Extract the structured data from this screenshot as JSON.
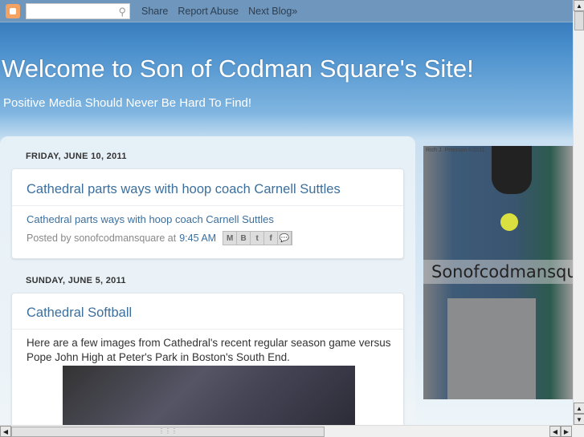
{
  "navbar": {
    "search_placeholder": "",
    "links": [
      "Share",
      "Report Abuse",
      "Next Blog»"
    ]
  },
  "header": {
    "title": "Welcome to Son of Codman Square's Site!",
    "description": "Positive Media Should Never Be Hard To Find!"
  },
  "posts": [
    {
      "date": "FRIDAY, JUNE 10, 2011",
      "title": "Cathedral parts ways with hoop coach Carnell Suttles",
      "body_link": "Cathedral parts ways with hoop coach Carnell Suttles",
      "posted_by": "Posted by sonofcodmansquare at",
      "time": "9:45 AM",
      "share_icons": [
        "M",
        "B",
        "t",
        "f",
        "💬"
      ]
    },
    {
      "date": "SUNDAY, JUNE 5, 2011",
      "title": "Cathedral Softball",
      "body": "Here are a few images from Cathedral's recent regular season game versus Pope John High at Peter's Park in Boston's South End."
    }
  ],
  "sidebar": {
    "caption": "Sonofcodmansquare",
    "credit": "Rich J. Peterson ©2011"
  }
}
